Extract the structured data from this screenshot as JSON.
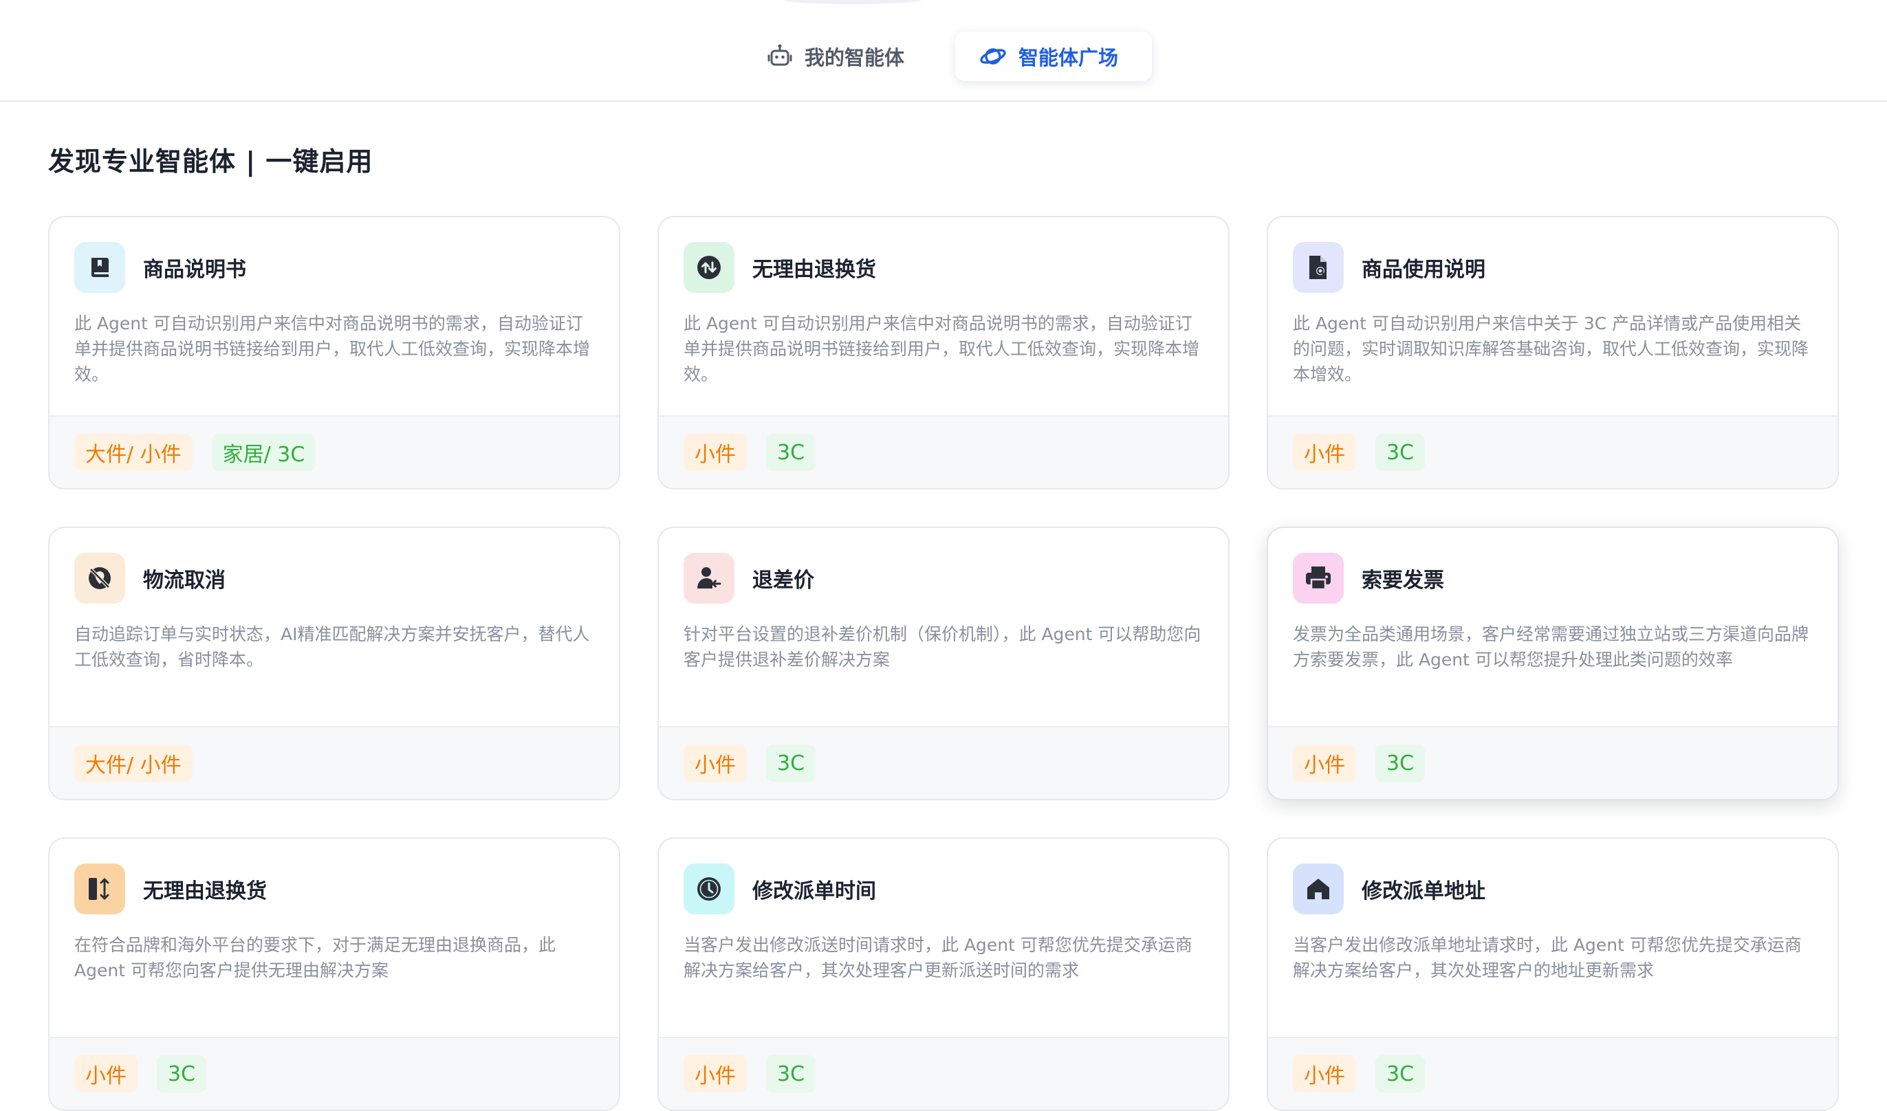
{
  "tabs": [
    {
      "label": "我的智能体",
      "icon": "robot-icon",
      "active": false
    },
    {
      "label": "智能体广场",
      "icon": "planet-icon",
      "active": true
    }
  ],
  "page_title": "发现专业智能体 | 一键启用",
  "colors": {
    "accent": "#1f5fe0",
    "tag_orange": "#f07a00",
    "tag_green": "#2fae3e"
  },
  "cards": [
    {
      "title": "商品说明书",
      "icon": "book-icon",
      "icon_bg": "#dff3fb",
      "desc": "此 Agent 可自动识别用户来信中对商品说明书的需求，自动验证订单并提供商品说明书链接给到用户，取代人工低效查询，实现降本增效。",
      "tags": [
        "大件/ 小件",
        "家居/ 3C"
      ]
    },
    {
      "title": "无理由退换货",
      "icon": "exchange-icon",
      "icon_bg": "#dcf5e4",
      "desc": "此 Agent 可自动识别用户来信中对商品说明书的需求，自动验证订单并提供商品说明书链接给到用户，取代人工低效查询，实现降本增效。",
      "tags": [
        "小件",
        "3C"
      ]
    },
    {
      "title": "商品使用说明",
      "icon": "document-search-icon",
      "icon_bg": "#e2e5fb",
      "desc": "此 Agent 可自动识别用户来信中关于 3C 产品详情或产品使用相关的问题，实时调取知识库解答基础咨询，取代人工低效查询，实现降本增效。",
      "tags": [
        "小件",
        "3C"
      ]
    },
    {
      "title": "物流取消",
      "icon": "cancel-location-icon",
      "icon_bg": "#fbecd9",
      "desc": "自动追踪订单与实时状态，AI精准匹配解决方案并安抚客户，替代人工低效查询，省时降本。",
      "tags": [
        "大件/ 小件"
      ]
    },
    {
      "title": "退差价",
      "icon": "user-refund-icon",
      "icon_bg": "#fbe2e2",
      "desc": "针对平台设置的退补差价机制（保价机制），此 Agent 可以帮助您向客户提供退补差价解决方案",
      "tags": [
        "小件",
        "3C"
      ]
    },
    {
      "title": "索要发票",
      "icon": "printer-icon",
      "icon_bg": "#fbd2ef",
      "desc": "发票为全品类通用场景，客户经常需要通过独立站或三方渠道向品牌方索要发票，此 Agent 可以帮您提升处理此类问题的效率",
      "tags": [
        "小件",
        "3C"
      ]
    },
    {
      "title": "无理由退换货",
      "icon": "swap-vertical-icon",
      "icon_bg": "#fbd3a3",
      "desc": "在符合品牌和海外平台的要求下，对于满足无理由退换商品，此 Agent 可帮您向客户提供无理由解决方案",
      "tags": [
        "小件",
        "3C"
      ]
    },
    {
      "title": "修改派单时间",
      "icon": "clock-icon",
      "icon_bg": "#c9f6f6",
      "desc": "当客户发出修改派送时间请求时，此 Agent 可帮您优先提交承运商解决方案给客户，其次处理客户更新派送时间的需求",
      "tags": [
        "小件",
        "3C"
      ]
    },
    {
      "title": "修改派单地址",
      "icon": "home-icon",
      "icon_bg": "#d6e2fb",
      "desc": "当客户发出修改派单地址请求时，此 Agent 可帮您优先提交承运商解决方案给客户，其次处理客户的地址更新需求",
      "tags": [
        "小件",
        "3C"
      ]
    }
  ]
}
